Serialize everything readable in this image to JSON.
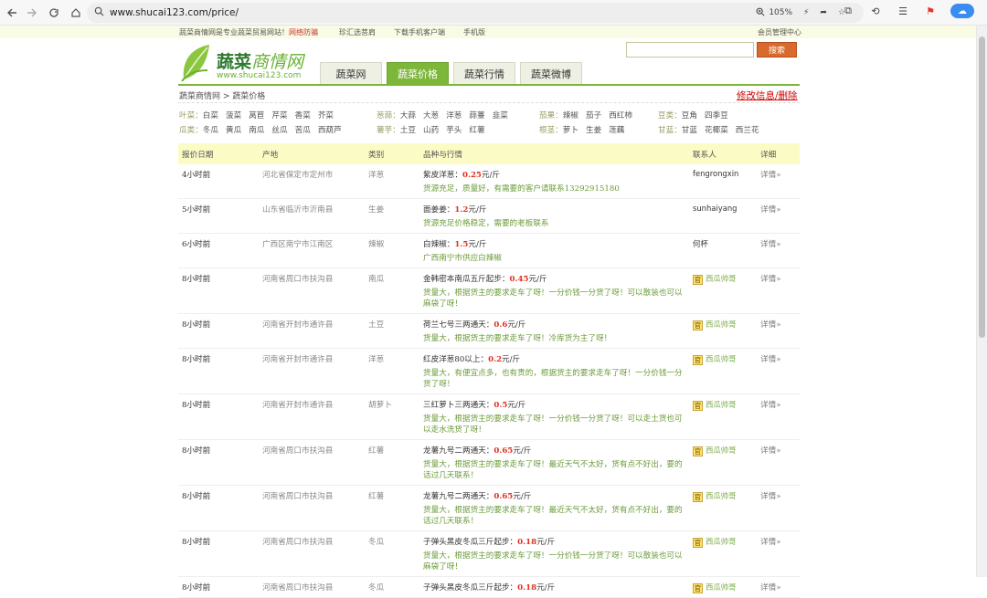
{
  "browser": {
    "url": "www.shucai123.com/price/",
    "zoom": "105%"
  },
  "topbar": {
    "message": "蔬菜商情网是专业蔬菜贸易网站！",
    "message_red": "网络防骗",
    "links": [
      "珍汇选菩肩",
      "下载手机客户端",
      "手机版"
    ],
    "member_center": "会员管理中心"
  },
  "logo": {
    "name": "蔬菜",
    "name2": "商情网",
    "url": "www.shucai123.com"
  },
  "search": {
    "placeholder": "",
    "button": "搜索"
  },
  "tabs": [
    {
      "label": "蔬菜网",
      "active": false
    },
    {
      "label": "蔬菜价格",
      "active": true
    },
    {
      "label": "蔬菜行情",
      "active": false
    },
    {
      "label": "蔬菜微博",
      "active": false
    }
  ],
  "breadcrumb": "蔬菜商情网 > 蔬菜价格",
  "edit_link": "修改信息/删除",
  "categories": {
    "row1": [
      {
        "label": "叶菜：",
        "items": [
          "白菜",
          "菠菜",
          "莴苣",
          "芹菜",
          "香菜",
          "芥菜"
        ]
      },
      {
        "label": "葱蒜：",
        "items": [
          "大蒜",
          "大葱",
          "洋葱",
          "蒜薹",
          "韭菜"
        ]
      },
      {
        "label": "茄果：",
        "items": [
          "辣椒",
          "茄子",
          "西红柿"
        ]
      },
      {
        "label": "豆类：",
        "items": [
          "豆角",
          "四季豆"
        ]
      }
    ],
    "row2": [
      {
        "label": "瓜类：",
        "items": [
          "冬瓜",
          "黄瓜",
          "南瓜",
          "丝瓜",
          "苦瓜",
          "西葫芦"
        ]
      },
      {
        "label": "薯芋：",
        "items": [
          "土豆",
          "山药",
          "芋头",
          "红薯"
        ]
      },
      {
        "label": "根茎：",
        "items": [
          "萝卜",
          "生姜",
          "莲藕"
        ]
      },
      {
        "label": "甘蓝：",
        "items": [
          "甘蓝",
          "花椰菜",
          "西兰花"
        ]
      }
    ]
  },
  "table": {
    "headers": [
      "报价日期",
      "产地",
      "类别",
      "品种与行情",
      "联系人",
      "详细"
    ],
    "rows": [
      {
        "date": "4小时前",
        "location": "河北省保定市定州市",
        "category": "洋葱",
        "product": "紫皮洋葱：",
        "price": "0.25",
        "unit": "元/斤",
        "desc": "货源充足，质量好，有需要的客户请联系13292915180",
        "contact": "fengrongxin",
        "badge": false,
        "detail": "详情»"
      },
      {
        "date": "5小时前",
        "location": "山东省临沂市沂南县",
        "category": "生姜",
        "product": "面姜姜：",
        "price": "1.2",
        "unit": "元/斤",
        "desc": "货源充足价格稳定，需要的老板联系",
        "contact": "sunhaiyang",
        "badge": false,
        "detail": "详情»"
      },
      {
        "date": "6小时前",
        "location": "广西区南宁市江南区",
        "category": "辣椒",
        "product": "白辣椒：",
        "price": "1.5",
        "unit": "元/斤",
        "desc": "广西南宁市供应白辣椒",
        "contact": "何杯",
        "badge": false,
        "detail": "详情»"
      },
      {
        "date": "8小时前",
        "location": "河南省周口市扶沟县",
        "category": "南瓜",
        "product": "金韩密本南瓜五斤起步：",
        "price": "0.45",
        "unit": "元/斤",
        "desc": "货量大，根据货主的要求走车了呀！一分价钱一分货了呀！可以散装也可以麻袋了呀！",
        "contact": "西瓜帅哥",
        "badge": true,
        "detail": "详情»"
      },
      {
        "date": "8小时前",
        "location": "河南省开封市通许县",
        "category": "土豆",
        "product": "荷兰七号三两通天：",
        "price": "0.6",
        "unit": "元/斤",
        "desc": "货量大，根据货主的要求走车了呀！冷库货为主了呀！",
        "contact": "西瓜帅哥",
        "badge": true,
        "detail": "详情»"
      },
      {
        "date": "8小时前",
        "location": "河南省开封市通许县",
        "category": "洋葱",
        "product": "红皮洋葱80以上：",
        "price": "0.2",
        "unit": "元/斤",
        "desc": "货量大，有便宜点多，也有贵的，根据货主的要求走车了呀！一分价钱一分货了呀！",
        "contact": "西瓜帅哥",
        "badge": true,
        "detail": "详情»"
      },
      {
        "date": "8小时前",
        "location": "河南省开封市通许县",
        "category": "胡萝卜",
        "product": "三红萝卜三两通天：",
        "price": "0.5",
        "unit": "元/斤",
        "desc": "货量大，根据货主的要求走车了呀！一分价钱一分货了呀！可以走土货也可以走水洗货了呀！",
        "contact": "西瓜帅哥",
        "badge": true,
        "detail": "详情»"
      },
      {
        "date": "8小时前",
        "location": "河南省周口市扶沟县",
        "category": "红薯",
        "product": "龙薯九号二两通天：",
        "price": "0.65",
        "unit": "元/斤",
        "desc": "货量大，根据货主的要求走车了呀！最近天气不太好，货有点不好出，要的话过几天联系！",
        "contact": "西瓜帅哥",
        "badge": true,
        "detail": "详情»"
      },
      {
        "date": "8小时前",
        "location": "河南省周口市扶沟县",
        "category": "红薯",
        "product": "龙薯九号二两通天：",
        "price": "0.65",
        "unit": "元/斤",
        "desc": "货量大，根据货主的要求走车了呀！最近天气不太好，货有点不好出，要的话过几天联系！",
        "contact": "西瓜帅哥",
        "badge": true,
        "detail": "详情»"
      },
      {
        "date": "8小时前",
        "location": "河南省周口市扶沟县",
        "category": "冬瓜",
        "product": "子弹头黑皮冬瓜三斤起步：",
        "price": "0.18",
        "unit": "元/斤",
        "desc": "货量大，根据货主的要求走车了呀！一分价钱一分货了呀！可以散装也可以麻袋了呀！",
        "contact": "西瓜帅哥",
        "badge": true,
        "detail": "详情»"
      },
      {
        "date": "8小时前",
        "location": "河南省周口市扶沟县",
        "category": "冬瓜",
        "product": "子弹头黑皮冬瓜三斤起步：",
        "price": "0.18",
        "unit": "元/斤",
        "desc": "",
        "contact": "西瓜帅哥",
        "badge": true,
        "detail": "详情»"
      }
    ]
  },
  "badge_text": "官"
}
